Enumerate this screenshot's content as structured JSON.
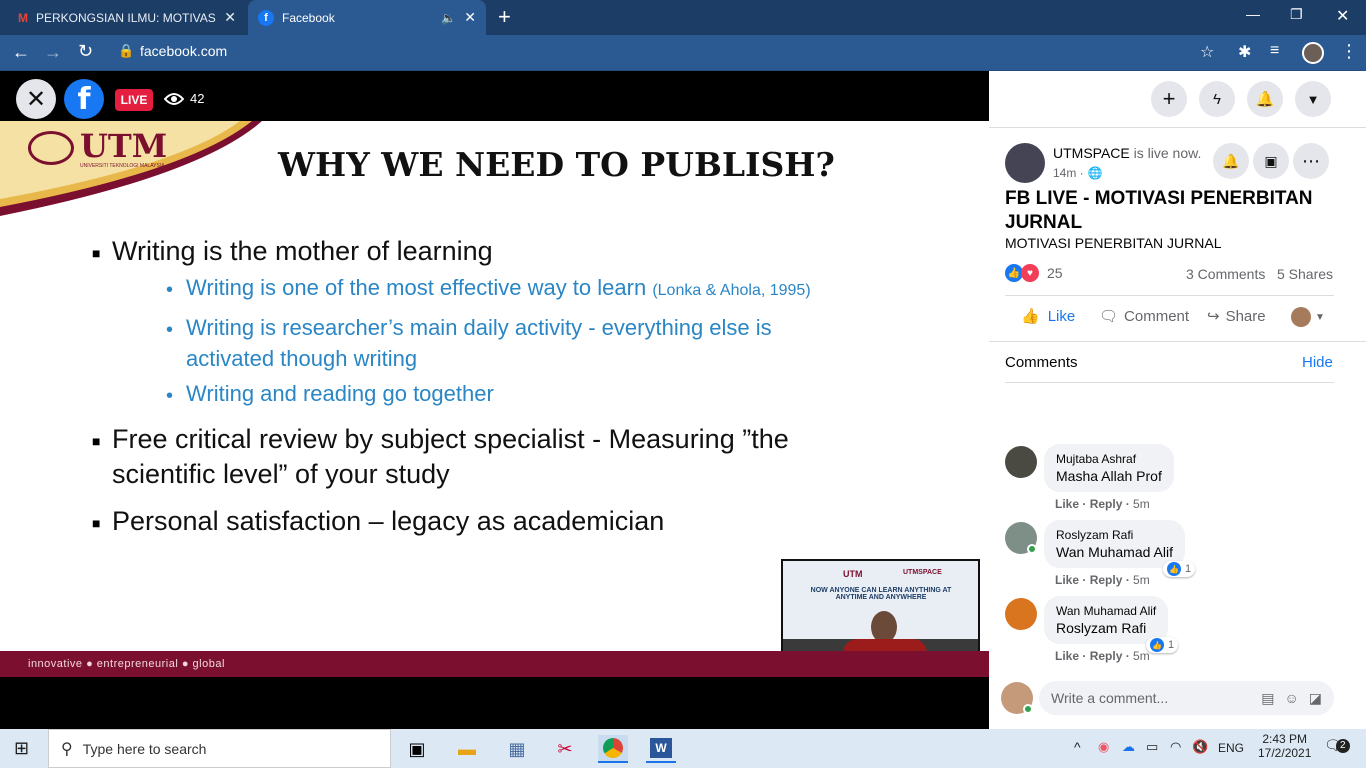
{
  "browser": {
    "tabs": [
      {
        "label": "PERKONGSIAN ILMU: MOTIVASI P"
      },
      {
        "label": "Facebook"
      }
    ],
    "url": "facebook.com"
  },
  "live": {
    "badge": "LIVE",
    "viewers": "42"
  },
  "slide": {
    "logo": "UTM",
    "logo_sub": "UNIVERSITI TEKNOLOGI MALAYSIA",
    "title": "WHY WE NEED TO PUBLISH?",
    "bullets": [
      {
        "text": "Writing is the mother of learning"
      },
      {
        "text": "Free critical review by subject specialist - Measuring ”the"
      },
      {
        "text": "scientific level” of your study"
      },
      {
        "text": "Personal satisfaction – legacy as academician"
      }
    ],
    "sub_bullets": [
      {
        "text": "Writing is one of the most effective way to  learn",
        "cite": "(Lonka & Ahola, 1995)"
      },
      {
        "text": "Writing is researcher’s main daily activity - everything else is"
      },
      {
        "text": "activated though  writing"
      },
      {
        "text": "Writing and reading go together"
      }
    ],
    "footer": "innovative ● entrepreneurial ● global",
    "pip_text": "NOW ANYONE CAN LEARN ANYTHING AT ANYTIME AND ANYWHERE",
    "pip_logo": "UTM",
    "pip_brand": "UTMSPACE"
  },
  "post": {
    "page_name": "UTMSPACE",
    "status": " is live now.",
    "time": "14m ·",
    "title": "FB LIVE - MOTIVASI PENERBITAN JURNAL",
    "subtitle": "MOTIVASI PENERBITAN JURNAL",
    "reactions": "25",
    "comments_count": "3 Comments",
    "shares": "5 Shares",
    "like": "Like",
    "comment": "Comment",
    "share": "Share"
  },
  "comments_section": {
    "label": "Comments",
    "hide": "Hide",
    "placeholder": "Write a comment..."
  },
  "comments": [
    {
      "name": "Mujtaba Ashraf",
      "text": "Masha Allah Prof",
      "like": "Like",
      "reply": "Reply",
      "time": "5m",
      "likes": ""
    },
    {
      "name": "Roslyzam Rafi",
      "text": "Wan Muhamad Alif",
      "like": "Like",
      "reply": "Reply",
      "time": "5m",
      "likes": "1"
    },
    {
      "name": "Wan Muhamad Alif",
      "text": "Roslyzam Rafi",
      "like": "Like",
      "reply": "Reply",
      "time": "5m",
      "likes": "1"
    }
  ],
  "taskbar": {
    "search": "Type here to search",
    "lang": "ENG",
    "time": "2:43 PM",
    "date": "17/2/2021",
    "notif": "2"
  },
  "colors": {
    "fb_blue": "#1877f2",
    "live_red": "#e41e3f",
    "utm_maroon": "#7b0f2f",
    "bullet_blue": "#2a86c5"
  }
}
